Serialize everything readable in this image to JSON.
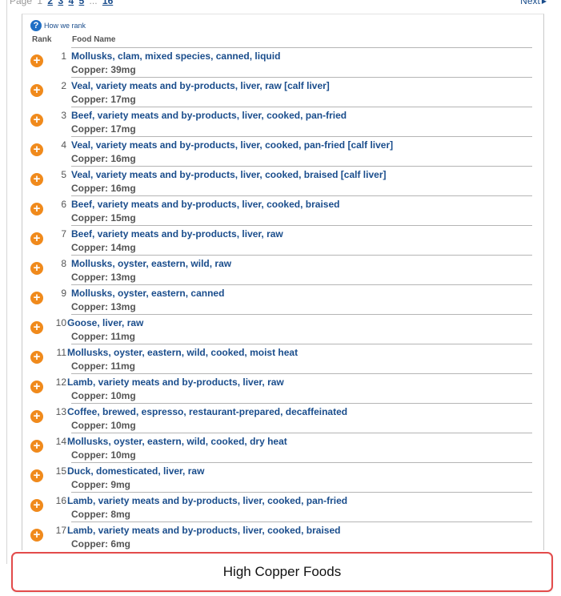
{
  "pager": {
    "label": "Page",
    "current": "1",
    "pages": [
      "2",
      "3",
      "4",
      "5"
    ],
    "ellipsis": "...",
    "last": "16",
    "next_label": "Next"
  },
  "how_we_rank": "How we rank",
  "columns": {
    "rank": "Rank",
    "food_name": "Food Name"
  },
  "foods": [
    {
      "rank": "1",
      "name": "Mollusks, clam, mixed species, canned, liquid",
      "nutrient": "Copper: 39mg"
    },
    {
      "rank": "2",
      "name": "Veal, variety meats and by-products, liver, raw [calf liver]",
      "nutrient": "Copper: 17mg"
    },
    {
      "rank": "3",
      "name": "Beef, variety meats and by-products, liver, cooked, pan-fried",
      "nutrient": "Copper: 17mg"
    },
    {
      "rank": "4",
      "name": "Veal, variety meats and by-products, liver, cooked, pan-fried [calf liver]",
      "nutrient": "Copper: 16mg"
    },
    {
      "rank": "5",
      "name": "Veal, variety meats and by-products, liver, cooked, braised [calf liver]",
      "nutrient": "Copper: 16mg"
    },
    {
      "rank": "6",
      "name": "Beef, variety meats and by-products, liver, cooked, braised",
      "nutrient": "Copper: 15mg"
    },
    {
      "rank": "7",
      "name": "Beef, variety meats and by-products, liver, raw",
      "nutrient": "Copper: 14mg"
    },
    {
      "rank": "8",
      "name": "Mollusks, oyster, eastern, wild, raw",
      "nutrient": "Copper: 13mg"
    },
    {
      "rank": "9",
      "name": "Mollusks, oyster, eastern, canned",
      "nutrient": "Copper: 13mg"
    },
    {
      "rank": "10",
      "name": "Goose, liver, raw",
      "nutrient": "Copper: 11mg"
    },
    {
      "rank": "11",
      "name": "Mollusks, oyster, eastern, wild, cooked, moist heat",
      "nutrient": "Copper: 11mg"
    },
    {
      "rank": "12",
      "name": "Lamb, variety meats and by-products, liver, raw",
      "nutrient": "Copper: 10mg"
    },
    {
      "rank": "13",
      "name": "Coffee, brewed, espresso, restaurant-prepared, decaffeinated",
      "nutrient": "Copper: 10mg"
    },
    {
      "rank": "14",
      "name": "Mollusks, oyster, eastern, wild, cooked, dry heat",
      "nutrient": "Copper: 10mg"
    },
    {
      "rank": "15",
      "name": "Duck, domesticated, liver, raw",
      "nutrient": "Copper: 9mg"
    },
    {
      "rank": "16",
      "name": "Lamb, variety meats and by-products, liver, cooked, pan-fried",
      "nutrient": "Copper: 8mg"
    },
    {
      "rank": "17",
      "name": "Lamb, variety meats and by-products, liver, cooked, braised",
      "nutrient": "Copper: 6mg"
    }
  ],
  "caption": "High Copper Foods",
  "icons": {
    "add": "plus-circle-icon",
    "help": "question-circle-icon",
    "next": "triangle-right-icon"
  },
  "colors": {
    "link": "#1a4d8c",
    "add_icon": "#f08a1c",
    "help_icon": "#1f6fc5",
    "caption_border": "#e34b4b"
  }
}
